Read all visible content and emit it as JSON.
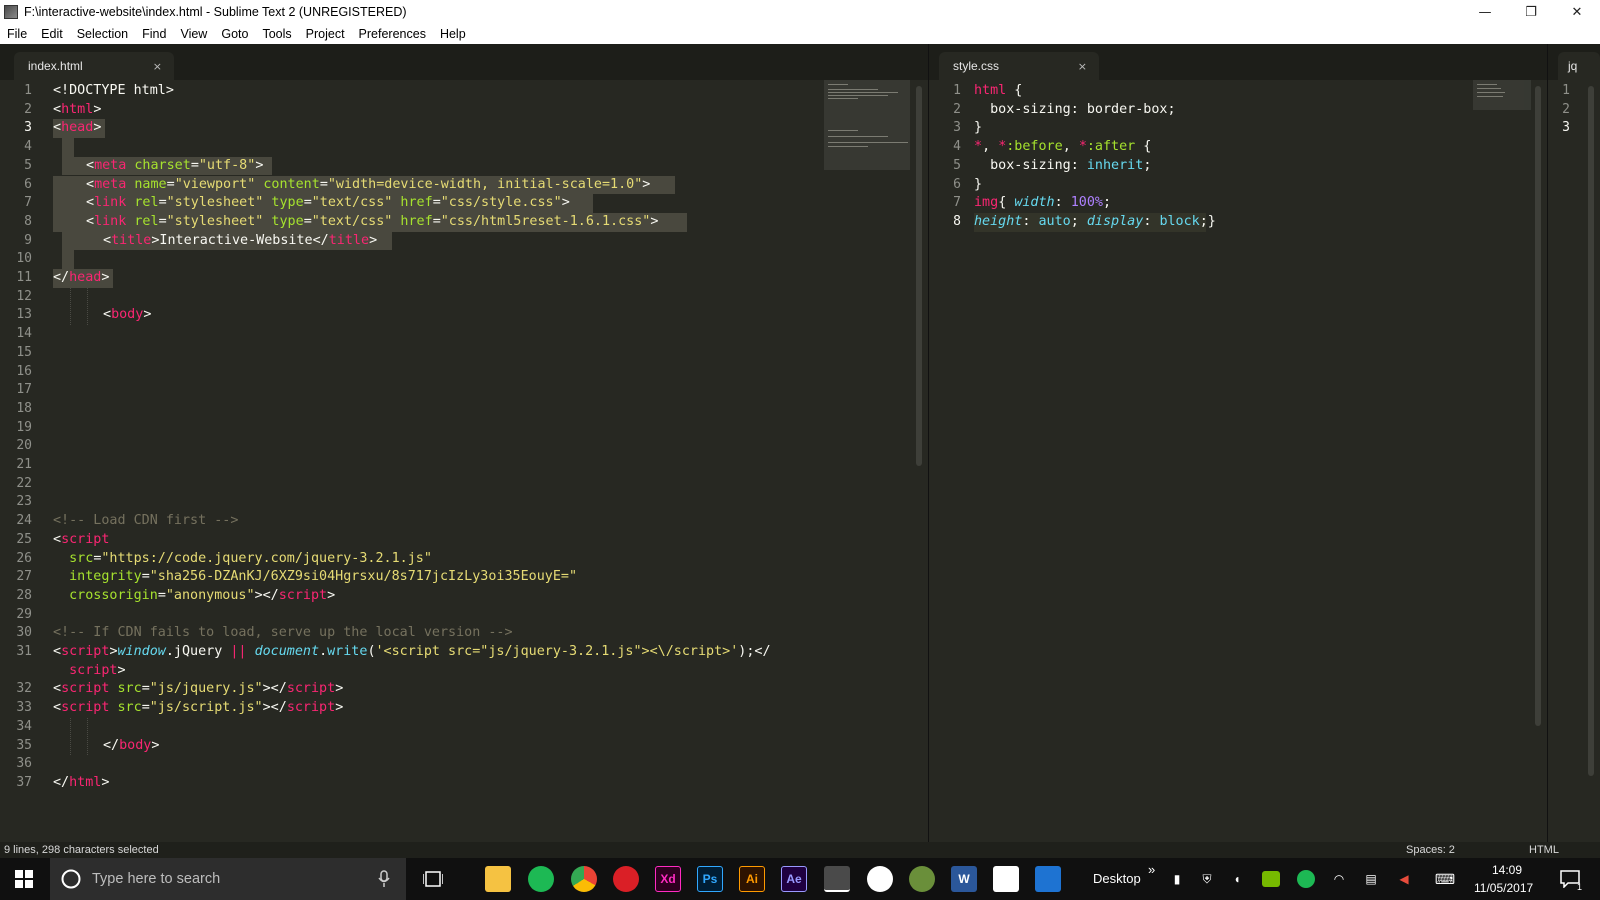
{
  "window": {
    "title": "F:\\interactive-website\\index.html - Sublime Text 2 (UNREGISTERED)",
    "minimize": "—",
    "restore": "❐",
    "close": "✕"
  },
  "menu": [
    "File",
    "Edit",
    "Selection",
    "Find",
    "View",
    "Goto",
    "Tools",
    "Project",
    "Preferences",
    "Help"
  ],
  "left_tab": {
    "label": "index.html",
    "close": "×"
  },
  "right_tab": {
    "label": "style.css",
    "close": "×"
  },
  "third_tab": {
    "label": "jq"
  },
  "left_lines": [
    "1",
    "2",
    "3",
    "4",
    "5",
    "6",
    "7",
    "8",
    "9",
    "10",
    "11",
    "12",
    "13",
    "14",
    "15",
    "16",
    "17",
    "18",
    "19",
    "20",
    "21",
    "22",
    "23",
    "24",
    "25",
    "26",
    "27",
    "28",
    "29",
    "30",
    "31",
    "",
    "32",
    "33",
    "34",
    "35",
    "36",
    "37"
  ],
  "left_current_line": "3",
  "left_code": {
    "l1a": "<!DOCTYPE html>",
    "l2a": "<",
    "l2b": "html",
    "l2c": ">",
    "l3a": "<",
    "l3b": "head",
    "l3c": ">",
    "l5a": "<",
    "l5b": "meta",
    "l5c": " charset",
    "l5d": "=",
    "l5e": "\"utf-8\"",
    "l5f": ">",
    "l6a": "<",
    "l6b": "meta",
    "l6c": " name",
    "l6d": "=",
    "l6e": "\"viewport\"",
    "l6f": " content",
    "l6g": "=",
    "l6h": "\"width=device-width, initial-scale=1.0\"",
    "l6i": ">",
    "l7a": "<",
    "l7b": "link",
    "l7c": " rel",
    "l7d": "=",
    "l7e": "\"stylesheet\"",
    "l7f": " type",
    "l7g": "=",
    "l7h": "\"text/css\"",
    "l7i": " href",
    "l7j": "=",
    "l7k": "\"css/style.css\"",
    "l7l": ">",
    "l8a": "<",
    "l8b": "link",
    "l8c": " rel",
    "l8d": "=",
    "l8e": "\"stylesheet\"",
    "l8f": " type",
    "l8g": "=",
    "l8h": "\"text/css\"",
    "l8i": " href",
    "l8j": "=",
    "l8k": "\"css/html5reset-1.6.1.css\"",
    "l8l": ">",
    "l9a": "<",
    "l9b": "title",
    "l9c": ">Interactive-Website</",
    "l9d": "title",
    "l9e": ">",
    "l11a": "</",
    "l11b": "head",
    "l11c": ">",
    "l13a": "<",
    "l13b": "body",
    "l13c": ">",
    "l24a": "<!-- Load CDN first -->",
    "l25a": "<",
    "l25b": "script",
    "l26a": "  src",
    "l26b": "=",
    "l26c": "\"https://code.jquery.com/jquery-3.2.1.js\"",
    "l27a": "  integrity",
    "l27b": "=",
    "l27c": "\"sha256-DZAnKJ/6XZ9si04Hgrsxu/8s717jcIzLy3oi35EouyE=\"",
    "l28a": "  crossorigin",
    "l28b": "=",
    "l28c": "\"anonymous\"",
    "l28d": "></",
    "l28e": "script",
    "l28f": ">",
    "l30a": "<!-- If CDN fails to load, serve up the local version -->",
    "l31a": "<",
    "l31b": "script",
    "l31c": ">",
    "l31d": "window",
    "l31e": ".jQuery ",
    "l31f": "||",
    "l31g": " ",
    "l31h": "document",
    "l31i": ".",
    "l31j": "write",
    "l31k": "(",
    "l31l": "'<script src=\"js/jquery-3.2.1.js\"><\\/script>'",
    "l31m": ");</",
    "l31wa": "  script",
    "l31wb": ">",
    "l32a": "<",
    "l32b": "script",
    "l32c": " src",
    "l32d": "=",
    "l32e": "\"js/jquery.js\"",
    "l32f": "></",
    "l32g": "script",
    "l32h": ">",
    "l33a": "<",
    "l33b": "script",
    "l33c": " src",
    "l33d": "=",
    "l33e": "\"js/script.js\"",
    "l33f": "></",
    "l33g": "script",
    "l33h": ">",
    "l35a": "</",
    "l35b": "body",
    "l35c": ">",
    "l37a": "</",
    "l37b": "html",
    "l37c": ">"
  },
  "right_lines": [
    "1",
    "2",
    "3",
    "4",
    "5",
    "6",
    "7",
    "8"
  ],
  "right_code": {
    "r1a": "html",
    "r1b": " {",
    "r2a": "  box-sizing",
    "r2b": ": border-box;",
    "r3a": "}",
    "r4a": "*",
    "r4b": ", ",
    "r4c": "*",
    "r4d": ":before",
    "r4e": ", ",
    "r4f": "*",
    "r4g": ":after",
    "r4h": " {",
    "r5a": "  box-sizing",
    "r5b": ": ",
    "r5c": "inherit",
    "r5d": ";",
    "r6a": "}",
    "r7a": "img",
    "r7b": "{ ",
    "r7c": "width",
    "r7d": ": ",
    "r7e": "100%",
    "r7f": ";",
    "r8a": "height",
    "r8b": ": ",
    "r8c": "auto",
    "r8d": "; ",
    "r8e": "display",
    "r8f": ": ",
    "r8g": "block",
    "r8h": ";}"
  },
  "third_lines": [
    "1",
    "2",
    "3"
  ],
  "status": {
    "selection": "9 lines, 298 characters selected",
    "spaces": "Spaces: 2",
    "syntax": "HTML"
  },
  "taskbar": {
    "search_placeholder": "Type here to search",
    "desktop": "Desktop",
    "chevron": "»",
    "time": "14:09",
    "date": "11/05/2017",
    "notif_count": "1",
    "apps": {
      "xd": "Xd",
      "ps": "Ps",
      "ai": "Ai",
      "ae": "Ae",
      "word": "W"
    }
  },
  "colors": {
    "editor_bg": "#272822",
    "tag": "#f92672",
    "attr": "#a6e22e",
    "string": "#e6db74",
    "comment": "#75715e",
    "keyword": "#66d9ef",
    "number": "#ae81ff",
    "selection": "#49483e"
  }
}
